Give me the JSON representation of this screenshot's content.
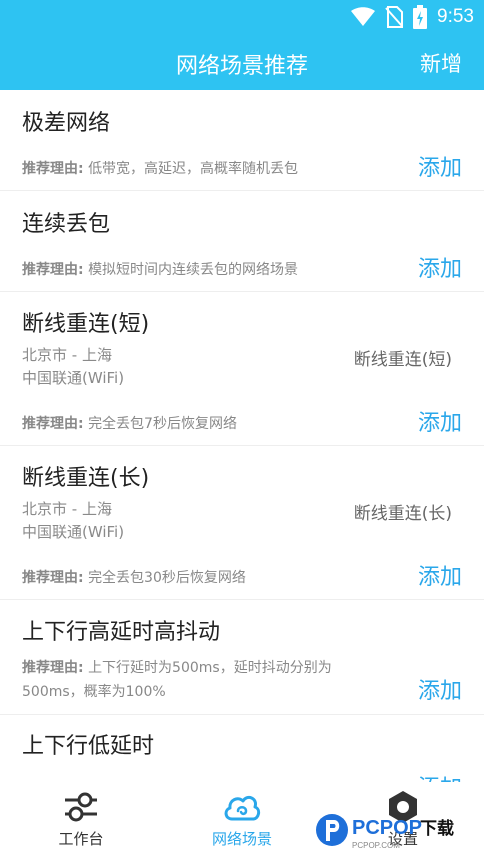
{
  "status": {
    "time": "9:53",
    "icons": [
      "wifi-icon",
      "no-sim-icon",
      "battery-charging-icon"
    ]
  },
  "appbar": {
    "title": "网络场景推荐",
    "action": "新增"
  },
  "colors": {
    "primary": "#2ec3f2",
    "accent": "#2aa7ea"
  },
  "scenarios": [
    {
      "title": "极差网络",
      "reason_label": "推荐理由:",
      "reason": "低带宽，高延迟，高概率随机丢包",
      "add": "添加"
    },
    {
      "title": "连续丢包",
      "reason_label": "推荐理由:",
      "reason": "模拟短时间内连续丢包的网络场景",
      "add": "添加"
    },
    {
      "title": "断线重连(短)",
      "location": "北京市 - 上海",
      "carrier": "中国联通(WiFi)",
      "type": "断线重连(短)",
      "reason_label": "推荐理由:",
      "reason": "完全丢包7秒后恢复网络",
      "add": "添加"
    },
    {
      "title": "断线重连(长)",
      "location": "北京市 - 上海",
      "carrier": "中国联通(WiFi)",
      "type": "断线重连(长)",
      "reason_label": "推荐理由:",
      "reason": "完全丢包30秒后恢复网络",
      "add": "添加"
    },
    {
      "title": "上下行高延时高抖动",
      "reason_label": "推荐理由:",
      "reason": "上下行延时为500ms，延时抖动分别为500ms，概率为100%",
      "add": "添加"
    },
    {
      "title": "上下行低延时",
      "add": "添加"
    }
  ],
  "tabs": [
    {
      "label": "工作台",
      "icon": "sliders-icon",
      "active": false
    },
    {
      "label": "网络场景",
      "icon": "cloud-icon",
      "active": true
    },
    {
      "label": "设置",
      "icon": "gear-icon",
      "active": false
    }
  ],
  "watermark": {
    "text": "PCPOP下载",
    "small": "PCPOP.COM"
  }
}
